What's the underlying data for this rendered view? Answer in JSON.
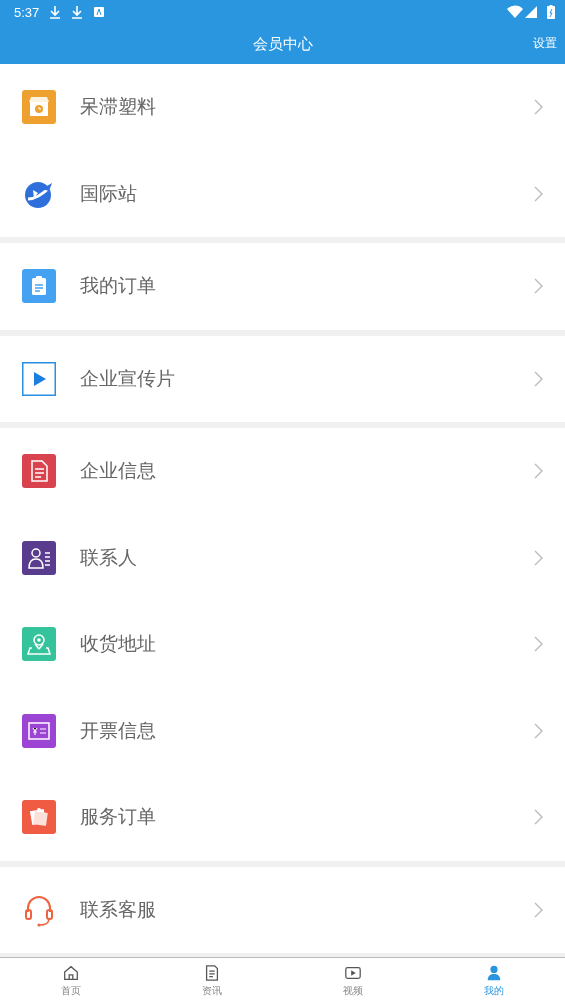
{
  "status_bar": {
    "time": "5:37"
  },
  "header": {
    "title": "会员中心",
    "action": "设置"
  },
  "groups": [
    {
      "items": [
        {
          "label": "呆滞塑料"
        },
        {
          "label": "国际站"
        }
      ]
    },
    {
      "items": [
        {
          "label": "我的订单"
        }
      ]
    },
    {
      "items": [
        {
          "label": "企业宣传片"
        }
      ]
    },
    {
      "items": [
        {
          "label": "企业信息"
        },
        {
          "label": "联系人"
        },
        {
          "label": "收货地址"
        },
        {
          "label": "开票信息"
        },
        {
          "label": "服务订单"
        }
      ]
    },
    {
      "items": [
        {
          "label": "联系客服"
        }
      ]
    }
  ],
  "tabs": [
    {
      "label": "首页",
      "selected": false
    },
    {
      "label": "资讯",
      "selected": false
    },
    {
      "label": "视频",
      "selected": false
    },
    {
      "label": "我的",
      "selected": true
    }
  ]
}
